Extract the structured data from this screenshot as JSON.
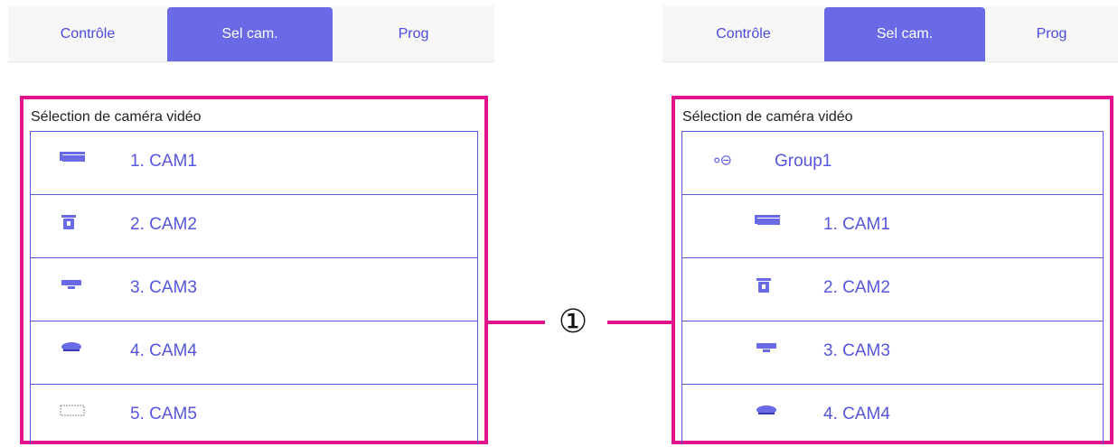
{
  "tabs": {
    "control": "Contrôle",
    "select_cam": "Sel cam.",
    "prog": "Prog"
  },
  "section_title": "Sélection de caméra vidéo",
  "left_list": [
    {
      "label": "1. CAM1",
      "icon": "box-camera-icon"
    },
    {
      "label": "2. CAM2",
      "icon": "ptz-camera-icon"
    },
    {
      "label": "3. CAM3",
      "icon": "dome-camera-icon"
    },
    {
      "label": "4. CAM4",
      "icon": "fisheye-camera-icon"
    },
    {
      "label": "5. CAM5",
      "icon": "generic-camera-icon"
    }
  ],
  "right_list": [
    {
      "label": "Group1",
      "icon": "group-collapse-icon"
    },
    {
      "label": "1. CAM1",
      "icon": "box-camera-icon"
    },
    {
      "label": "2. CAM2",
      "icon": "ptz-camera-icon"
    },
    {
      "label": "3. CAM3",
      "icon": "dome-camera-icon"
    },
    {
      "label": "4. CAM4",
      "icon": "fisheye-camera-icon"
    }
  ],
  "callout_number": "①",
  "colors": {
    "accent": "#6a6ae6",
    "list_text": "#5555dd",
    "highlight": "#e0138c"
  }
}
